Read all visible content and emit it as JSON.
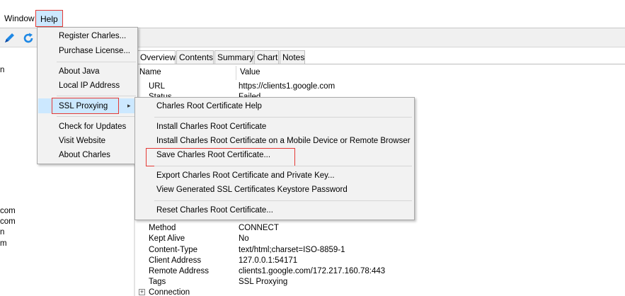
{
  "menubar": {
    "window_label": "Window",
    "help_label": "Help"
  },
  "left_list": [
    "n",
    "com",
    "com",
    "n",
    "m"
  ],
  "tabs": [
    "Overview",
    "Contents",
    "Summary",
    "Chart",
    "Notes"
  ],
  "columns": {
    "name": "Name",
    "value": "Value"
  },
  "rows_top": [
    {
      "name": "URL",
      "value": "https://clients1.google.com"
    },
    {
      "name": "Status",
      "value": "Failed"
    }
  ],
  "rows_bottom": [
    {
      "name": "Method",
      "value": "CONNECT"
    },
    {
      "name": "Kept Alive",
      "value": "No"
    },
    {
      "name": "Content-Type",
      "value": "text/html;charset=ISO-8859-1"
    },
    {
      "name": "Client Address",
      "value": "127.0.0.1:54171"
    },
    {
      "name": "Remote Address",
      "value": "clients1.google.com/172.217.160.78:443"
    },
    {
      "name": "Tags",
      "value": "SSL Proxying"
    },
    {
      "name": "Connection",
      "value": ""
    }
  ],
  "help_menu": {
    "items": [
      "Register Charles...",
      "Purchase License...",
      "About Java",
      "Local IP Address",
      "SSL Proxying",
      "Check for Updates",
      "Visit Website",
      "About Charles"
    ]
  },
  "ssl_submenu": {
    "items": [
      "Charles Root Certificate Help",
      "Install Charles Root Certificate",
      "Install Charles Root Certificate on a Mobile Device or Remote Browser",
      "Save Charles Root Certificate...",
      "Export Charles Root Certificate and Private Key...",
      "View Generated SSL Certificates Keystore Password",
      "Reset Charles Root Certificate..."
    ]
  },
  "icons": {
    "toolbar": [
      "pen-icon",
      "refresh-icon"
    ],
    "submenu_arrow": "chevron-right-icon",
    "expander": "plus-icon"
  },
  "colors": {
    "highlight": "#cce8ff",
    "annotation_red": "#e53935",
    "toolbar_blue": "#1e88e5"
  }
}
